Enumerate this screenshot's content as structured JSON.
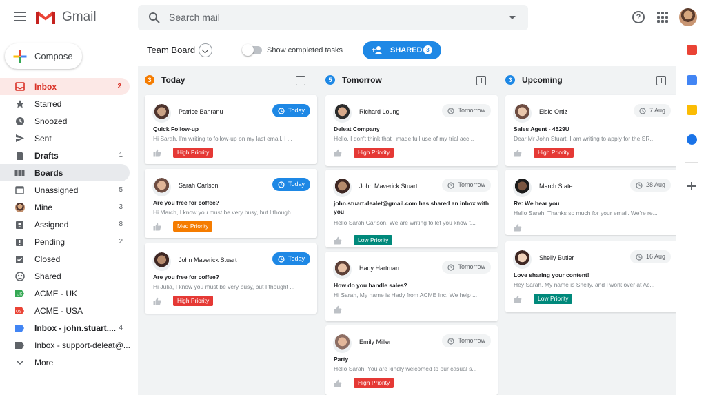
{
  "app": {
    "name": "Gmail"
  },
  "search": {
    "placeholder": "Search mail"
  },
  "compose": {
    "label": "Compose"
  },
  "sidebar": {
    "items": [
      {
        "label": "Inbox",
        "count": "2",
        "icon": "inbox-icon"
      },
      {
        "label": "Starred",
        "count": "",
        "icon": "star-icon"
      },
      {
        "label": "Snoozed",
        "count": "",
        "icon": "clock-icon"
      },
      {
        "label": "Sent",
        "count": "",
        "icon": "send-icon"
      },
      {
        "label": "Drafts",
        "count": "1",
        "icon": "draft-icon"
      },
      {
        "label": "Boards",
        "count": "",
        "icon": "board-icon"
      },
      {
        "label": "Unassigned",
        "count": "5",
        "icon": "unassigned-icon"
      },
      {
        "label": "Mine",
        "count": "3",
        "icon": "user-avatar-icon"
      },
      {
        "label": "Assigned",
        "count": "8",
        "icon": "assigned-icon"
      },
      {
        "label": "Pending",
        "count": "2",
        "icon": "pending-icon"
      },
      {
        "label": "Closed",
        "count": "",
        "icon": "check-box-icon"
      },
      {
        "label": "Shared",
        "count": "",
        "icon": "shared-icon"
      },
      {
        "label": "ACME - UK",
        "count": "",
        "icon": "green-label-icon"
      },
      {
        "label": "ACME - USA",
        "count": "",
        "icon": "red-label-icon"
      },
      {
        "label": "Inbox - john.stuart....",
        "count": "4",
        "icon": "blue-label-icon"
      },
      {
        "label": "Inbox - support-deleat@...",
        "count": "",
        "icon": "gray-label-icon"
      },
      {
        "label": "More",
        "count": "",
        "icon": "chevron-down-icon"
      }
    ]
  },
  "toolbar": {
    "board_title": "Team Board",
    "toggle_label": "Show completed tasks",
    "shared_label": "SHARED",
    "shared_count": "3"
  },
  "columns": [
    {
      "title": "Today",
      "count": "3",
      "color": "#f57c00",
      "cards": [
        {
          "name": "Patrice Bahranu",
          "date": "Today",
          "subject": "Quick Follow-up",
          "snippet": "Hi Sarah, I'm writing to follow-up on my last email. I ...",
          "priority": "High Priority",
          "priority_color": "#e53935"
        },
        {
          "name": "Sarah Carlson",
          "date": "Today",
          "subject": "Are you free for coffee?",
          "snippet": "Hi March, I know you must be very busy, but I though...",
          "priority": "Med Priority",
          "priority_color": "#f57c00"
        },
        {
          "name": "John Maverick Stuart",
          "date": "Today",
          "subject": "Are you free for coffee?",
          "snippet": "Hi Julia, I know you must be very busy, but I thought ...",
          "priority": "High Priority",
          "priority_color": "#e53935"
        }
      ]
    },
    {
      "title": "Tomorrow",
      "count": "5",
      "color": "#1e88e5",
      "cards": [
        {
          "name": "Richard Loung",
          "date": "Tomorrow",
          "subject": "Deleat Company",
          "snippet": "Hello, I don't think that I made full use of my trial acc...",
          "priority": "High Priority",
          "priority_color": "#e53935"
        },
        {
          "name": "John Maverick Stuart",
          "date": "Tomorrow",
          "subject": "john.stuart.dealet@gmail.com has shared an inbox with you",
          "snippet": "Hello Sarah Carlson, We are writing to let you know t...",
          "priority": "Low Priority",
          "priority_color": "#00897b"
        },
        {
          "name": "Hady Hartman",
          "date": "Tomorrow",
          "subject": "How do you handle sales?",
          "snippet": "Hi Sarah, My name is Hady from ACME Inc. We help ...",
          "priority": "",
          "priority_color": ""
        },
        {
          "name": "Emily Miller",
          "date": "Tomorrow",
          "subject": "Party",
          "snippet": "Hello Sarah, You are kindly welcomed to our casual s...",
          "priority": "High Priority",
          "priority_color": "#e53935"
        }
      ]
    },
    {
      "title": "Upcoming",
      "count": "3",
      "color": "#1e88e5",
      "cards": [
        {
          "name": "Elsie Ortiz",
          "date": "7 Aug",
          "subject": "Sales Agent - 4529U",
          "snippet": "Dear Mr John Stuart, I am writing to apply for the SR...",
          "priority": "High Priority",
          "priority_color": "#e53935"
        },
        {
          "name": "March State",
          "date": "28 Aug",
          "subject": "Re: We hear you",
          "snippet": "Hello Sarah, Thanks so much for your email. We're re...",
          "priority": "",
          "priority_color": ""
        },
        {
          "name": "Shelly Butler",
          "date": "16 Aug",
          "subject": "Love sharing your content!",
          "snippet": "Hey Sarah, My name is Shelly, and I work over at Ac...",
          "priority": "Low Priority",
          "priority_color": "#00897b"
        }
      ]
    }
  ],
  "right_panel": {
    "icons": [
      "calendar-icon",
      "tasks-icon",
      "keep-icon",
      "check-circle-icon",
      "add-icon"
    ]
  }
}
